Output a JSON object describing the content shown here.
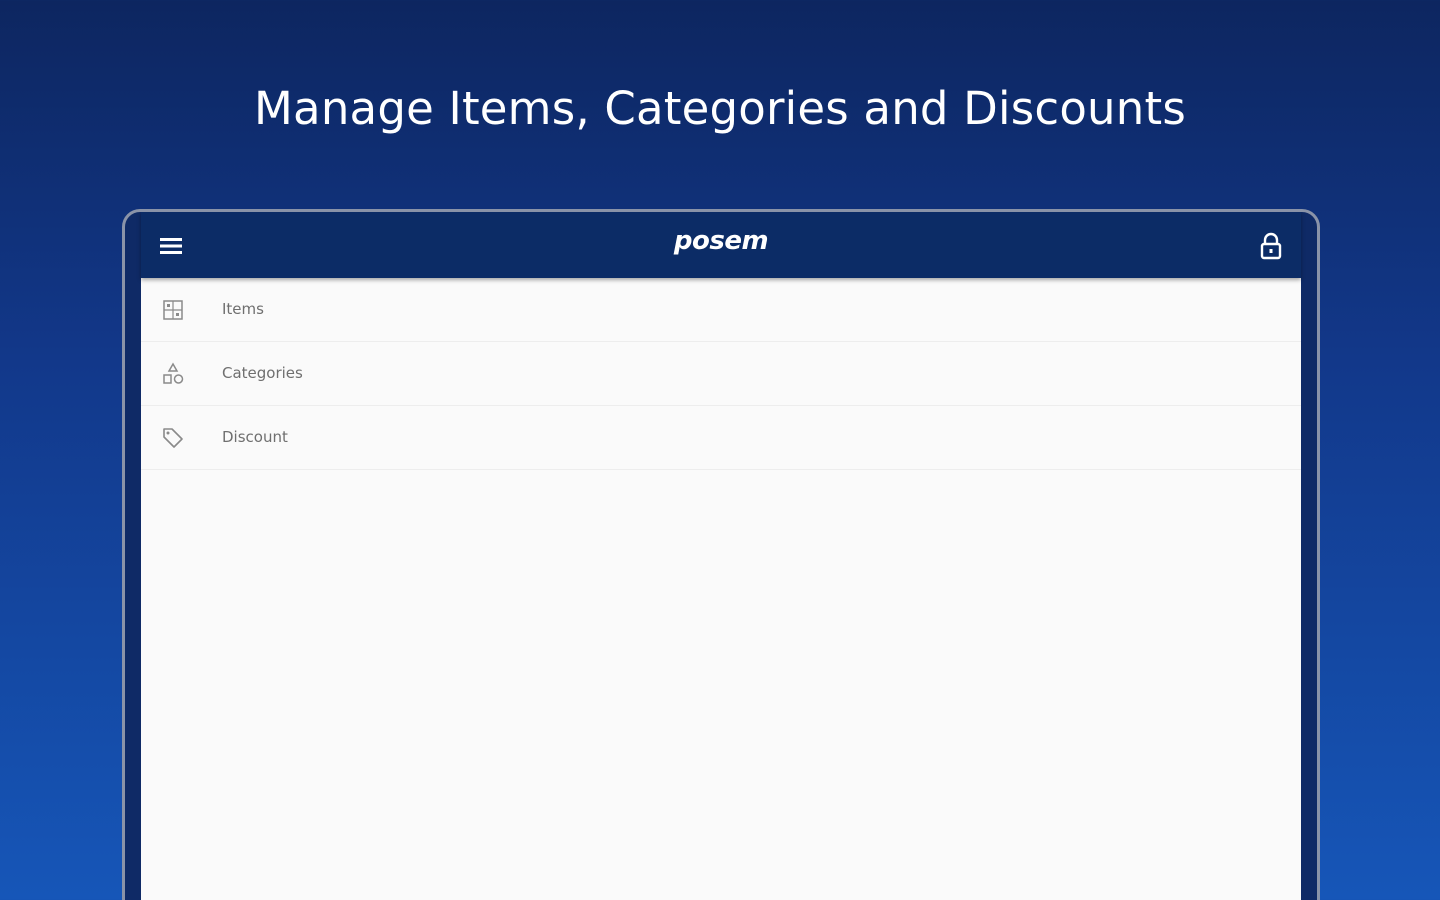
{
  "headline": "Manage Items, Categories and Discounts",
  "app": {
    "logo_text": "posem",
    "menu_icon": "hamburger-menu-icon",
    "lock_icon": "lock-icon"
  },
  "menu_items": [
    {
      "label": "Items",
      "icon": "items-grid-icon"
    },
    {
      "label": "Categories",
      "icon": "categories-shapes-icon"
    },
    {
      "label": "Discount",
      "icon": "tag-icon"
    }
  ],
  "colors": {
    "appbar": "#0c2c66",
    "background_top": "#0d2660",
    "background_bottom": "#1656b8",
    "icon_gray": "#8a8a8a"
  }
}
